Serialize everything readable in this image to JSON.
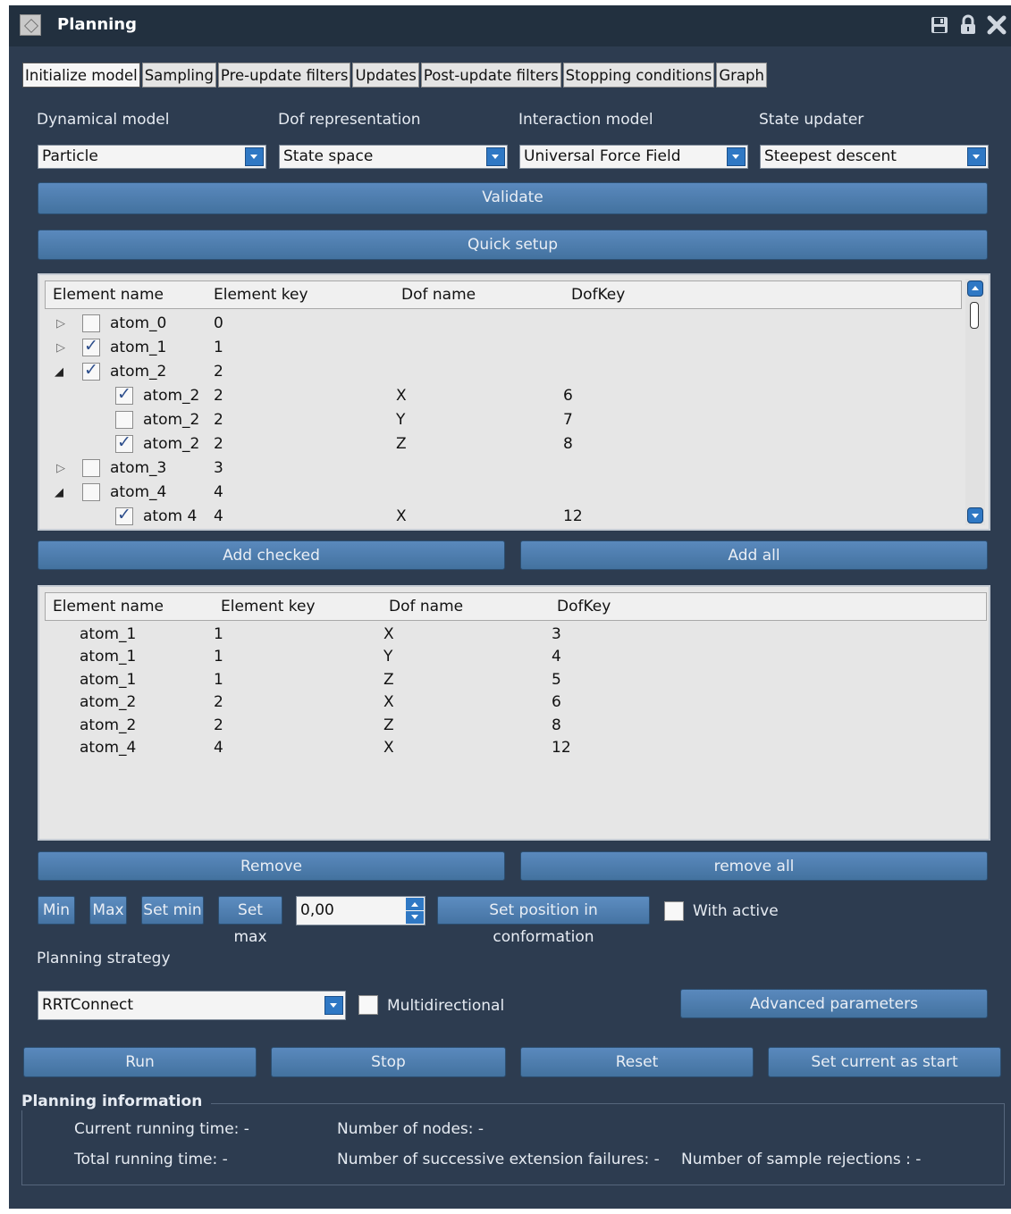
{
  "window": {
    "title": "Planning"
  },
  "tabs": [
    "Initialize model",
    "Sampling",
    "Pre-update filters",
    "Updates",
    "Post-update filters",
    "Stopping conditions",
    "Graph"
  ],
  "model": {
    "dynamical_model": {
      "label": "Dynamical model",
      "value": "Particle"
    },
    "dof_representation": {
      "label": "Dof representation",
      "value": "State space"
    },
    "interaction_model": {
      "label": "Interaction model",
      "value": "Universal Force Field"
    },
    "state_updater": {
      "label": "State updater",
      "value": "Steepest descent"
    }
  },
  "buttons": {
    "validate": "Validate",
    "quick_setup": "Quick setup",
    "add_checked": "Add checked",
    "add_all": "Add all",
    "remove": "Remove",
    "remove_all": "remove all",
    "min": "Min",
    "max": "Max",
    "set_min": "Set min",
    "set_max": "Set max",
    "set_position": "Set position in conformation",
    "advanced": "Advanced parameters",
    "run": "Run",
    "stop": "Stop",
    "reset": "Reset",
    "set_current_start": "Set current as start"
  },
  "tree_table": {
    "columns": [
      "Element name",
      "Element key",
      "Dof name",
      "DofKey"
    ],
    "rows": [
      {
        "expander": "collapsed",
        "checked": false,
        "name": "atom_0",
        "key": "0",
        "dof": "",
        "dofkey": ""
      },
      {
        "expander": "collapsed",
        "checked": true,
        "name": "atom_1",
        "key": "1",
        "dof": "",
        "dofkey": ""
      },
      {
        "expander": "expanded",
        "checked": true,
        "name": "atom_2",
        "key": "2",
        "dof": "",
        "dofkey": ""
      },
      {
        "expander": "none",
        "checked": true,
        "name": "atom_2",
        "key": "2",
        "dof": "X",
        "dofkey": "6"
      },
      {
        "expander": "none",
        "checked": false,
        "name": "atom_2",
        "key": "2",
        "dof": "Y",
        "dofkey": "7"
      },
      {
        "expander": "none",
        "checked": true,
        "name": "atom_2",
        "key": "2",
        "dof": "Z",
        "dofkey": "8"
      },
      {
        "expander": "collapsed",
        "checked": false,
        "name": "atom_3",
        "key": "3",
        "dof": "",
        "dofkey": ""
      },
      {
        "expander": "expanded",
        "checked": false,
        "name": "atom_4",
        "key": "4",
        "dof": "",
        "dofkey": ""
      },
      {
        "expander": "none",
        "checked": true,
        "name": "atom 4",
        "key": "4",
        "dof": "X",
        "dofkey": "12"
      }
    ]
  },
  "selected_table": {
    "columns": [
      "Element name",
      "Element key",
      "Dof name",
      "DofKey"
    ],
    "rows": [
      {
        "name": "atom_1",
        "key": "1",
        "dof": "X",
        "dofkey": "3"
      },
      {
        "name": "atom_1",
        "key": "1",
        "dof": "Y",
        "dofkey": "4"
      },
      {
        "name": "atom_1",
        "key": "1",
        "dof": "Z",
        "dofkey": "5"
      },
      {
        "name": "atom_2",
        "key": "2",
        "dof": "X",
        "dofkey": "6"
      },
      {
        "name": "atom_2",
        "key": "2",
        "dof": "Z",
        "dofkey": "8"
      },
      {
        "name": "atom_4",
        "key": "4",
        "dof": "X",
        "dofkey": "12"
      }
    ]
  },
  "position": {
    "value": "0,00",
    "with_active_label": "With active",
    "with_active_checked": false
  },
  "strategy": {
    "label": "Planning strategy",
    "value": "RRTConnect",
    "multidirectional_label": "Multidirectional",
    "multidirectional_checked": false
  },
  "info": {
    "title": "Planning information",
    "current_running_time": "Current running time: -",
    "total_running_time": "Total running time: -",
    "number_of_nodes": "Number of nodes: -",
    "extension_failures": "Number of successive extension failures: -",
    "sample_rejections": "Number of sample rejections : -"
  }
}
